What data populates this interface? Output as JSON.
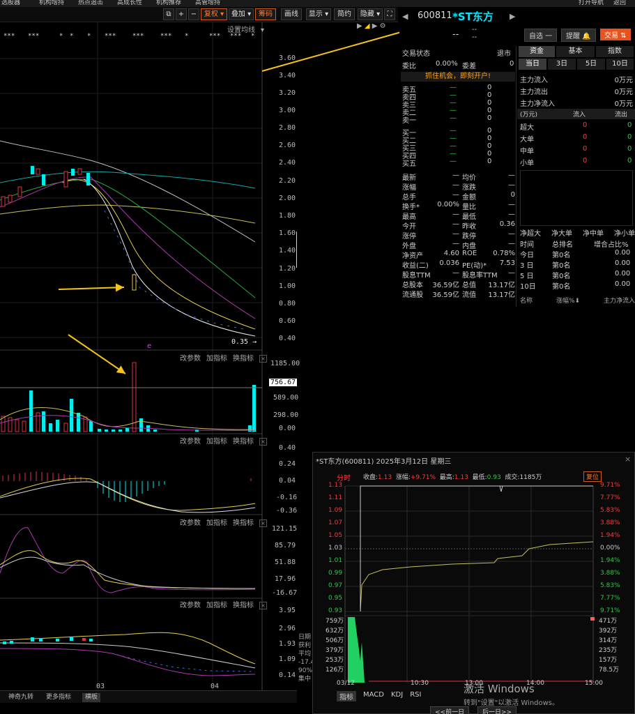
{
  "top_menu": [
    "选股器",
    "机构增持",
    "热点追击",
    "高成长性",
    "机构推荐",
    "高管增持",
    "打开导航",
    "返回"
  ],
  "toolbar": {
    "buttons": [
      "复权",
      "叠加",
      "筹码",
      "画线",
      "显示",
      "简约",
      "隐藏"
    ],
    "icons": [
      "copy-icon",
      "plus-icon",
      "minus-icon",
      "fullscreen-icon"
    ]
  },
  "chart": {
    "ma_settings": "设置均线",
    "price_axis": [
      "3.60",
      "3.40",
      "3.20",
      "3.00",
      "2.80",
      "2.60",
      "2.40",
      "2.20",
      "2.00",
      "1.80",
      "1.60",
      "1.40",
      "1.20",
      "1.00",
      "0.80",
      "0.60",
      "0.40"
    ],
    "low_label": "0.35 →",
    "marker_e": "e",
    "volume_axis": [
      "1185.00",
      "756.67",
      "589.00",
      "298.00",
      "0.00"
    ],
    "macd_axis": [
      "0.40",
      "0.24",
      "0.04",
      "-0.16",
      "-0.36"
    ],
    "kdj_axis": [
      "121.15",
      "85.79",
      "51.88",
      "17.96",
      "-16.67"
    ],
    "bottom_axis": [
      "3.95",
      "2.96",
      "1.93",
      "1.09",
      "0.14"
    ],
    "subbar": [
      "改参数",
      "加指标",
      "换指标"
    ],
    "close": "×",
    "x_labels": [
      "03",
      "04"
    ],
    "side_labels": [
      "日期",
      "获利",
      "平均",
      "-17.4",
      "90%",
      "集中"
    ],
    "bottom_tabs": [
      "神奇九转",
      "更多指标",
      "横板"
    ]
  },
  "stock": {
    "code": "600811",
    "name": "*ST东方",
    "price": "--",
    "change1": "--",
    "change2": "--",
    "zixuan": "自选 一",
    "tixing": "提醒",
    "jiaoyi": "交易"
  },
  "quote": {
    "status_label": "交易状态",
    "status_value": "退市",
    "weibi_label": "委比",
    "weibi_value": "0.00%",
    "weicha_label": "委差",
    "weicha_value": "0",
    "banner": "抓住机会，即刻开户!",
    "sell": [
      "卖五",
      "卖四",
      "卖三",
      "卖二",
      "卖一"
    ],
    "buy": [
      "买一",
      "买二",
      "买三",
      "买四",
      "买五"
    ],
    "dash": "—",
    "zero": "0",
    "stats_left": [
      [
        "最新",
        "—"
      ],
      [
        "涨幅",
        "—"
      ],
      [
        "总手",
        "—"
      ],
      [
        "换手*",
        "0.00%"
      ],
      [
        "最高",
        "—"
      ],
      [
        "今开",
        "—"
      ],
      [
        "涨停",
        "—"
      ],
      [
        "外盘",
        "—"
      ],
      [
        "净资产",
        "4.60"
      ],
      [
        "收益(二)",
        "0.036"
      ],
      [
        "股息TTM",
        "—"
      ],
      [
        "总股本",
        "36.59亿"
      ],
      [
        "流通股",
        "36.59亿"
      ]
    ],
    "stats_right": [
      [
        "均价",
        "—"
      ],
      [
        "涨跌",
        "—"
      ],
      [
        "金额",
        "0"
      ],
      [
        "量比",
        "—"
      ],
      [
        "最低",
        "—"
      ],
      [
        "昨收",
        "0.36"
      ],
      [
        "跌停",
        "—"
      ],
      [
        "内盘",
        "—"
      ],
      [
        "ROE",
        "0.78%"
      ],
      [
        "PE(动)*",
        "7.53"
      ],
      [
        "股息率TTM",
        "—"
      ],
      [
        "总值",
        "13.17亿"
      ],
      [
        "流值",
        "13.17亿"
      ]
    ]
  },
  "fund": {
    "tabs": [
      "资金",
      "基本",
      "指数"
    ],
    "periods": [
      "当日",
      "3日",
      "5日",
      "10日"
    ],
    "flows": [
      [
        "主力流入",
        "0万元"
      ],
      [
        "主力流出",
        "0万元"
      ],
      [
        "主力净流入",
        "0万元"
      ]
    ],
    "table_header": [
      "(万元)",
      "流入",
      "流出"
    ],
    "table_rows": [
      [
        "超大",
        "0",
        "0"
      ],
      [
        "大单",
        "0",
        "0"
      ],
      [
        "中单",
        "0",
        "0"
      ],
      [
        "小单",
        "0",
        "0"
      ]
    ],
    "legend": [
      "净超大",
      "净大单",
      "净中单",
      "净小单"
    ],
    "rank_header": [
      "时间",
      "总排名",
      "增合占比%"
    ],
    "rank_rows": [
      [
        "今日",
        "第0名",
        "0.00"
      ],
      [
        "3 日",
        "第0名",
        "0.00"
      ],
      [
        "5 日",
        "第0名",
        "0.00"
      ],
      [
        "10日",
        "第0名",
        "0.00"
      ]
    ],
    "list_header": [
      "名称",
      "涨幅%⬇",
      "主力净流入"
    ]
  },
  "popup": {
    "title": "*ST东方(600811) 2025年3月12日 星期三",
    "mode": "分时",
    "info": [
      [
        "收盘:",
        "1.13"
      ],
      [
        "涨幅:",
        "+9.71%"
      ],
      [
        "最高:",
        "1.13"
      ],
      [
        "最低:",
        "0.93"
      ],
      [
        "成交:",
        "1185万"
      ]
    ],
    "restore": "复位",
    "price_ticks": [
      "1.13",
      "1.11",
      "1.09",
      "1.07",
      "1.05",
      "1.03",
      "1.01",
      "0.99",
      "0.97",
      "0.95",
      "0.93"
    ],
    "pct_ticks": [
      "9.71%",
      "7.77%",
      "5.83%",
      "3.88%",
      "1.94%",
      "0.00%",
      "1.94%",
      "3.88%",
      "5.83%",
      "7.77%",
      "9.71%"
    ],
    "vol_left": [
      "759万",
      "632万",
      "506万",
      "379万",
      "253万",
      "126万"
    ],
    "vol_right": [
      "471万",
      "392万",
      "314万",
      "235万",
      "157万",
      "78.5万"
    ],
    "time_ticks": [
      "03/12",
      "10:30",
      "13:00",
      "14:00",
      "15:00"
    ],
    "tabs": [
      "指标",
      "MACD",
      "KDJ",
      "RSI"
    ],
    "nav": [
      "<<前一日",
      "后一日>>"
    ],
    "watermark1": "激活 Windows",
    "watermark2": "转到\"设置\"以激活 Windows。",
    "close": "×"
  }
}
